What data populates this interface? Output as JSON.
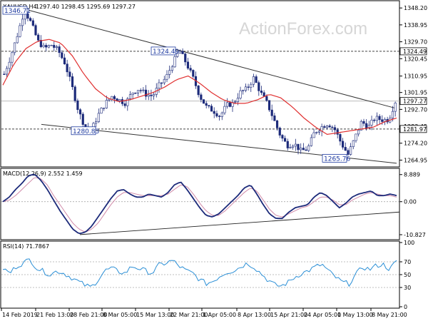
{
  "header": {
    "symbol": "XAUUSD,H4",
    "ohlc": "1297.40 1298.45 1295.69 1297.27",
    "macd_label": "MACD(12,26,9) 2.552 1.459",
    "rsi_label": "RSI(14) 71.7867"
  },
  "watermark": "ActionForex.com",
  "colors": {
    "candle": "#1c2a7a",
    "ma": "#e03030",
    "macd": "#1c2a7a",
    "signal": "#d08aa8",
    "rsi": "#2b8fd6",
    "trend": "#333333",
    "level_dash": "#444444",
    "annotation": "#1e3aa0"
  },
  "chart_data": [
    {
      "type": "candlestick",
      "title": "XAUUSD,H4",
      "ylim": [
        1262,
        1351
      ],
      "y_ticks": [
        "1348.20",
        "1338.95",
        "1329.70",
        "1320.45",
        "1310.95",
        "1301.95",
        "1292.70",
        "1283.45",
        "1274.20",
        "1264.95"
      ],
      "x_ticks": [
        "14 Feb 2019",
        "21 Feb 13:00",
        "28 Feb 21:00",
        "8 Mar 05:00",
        "15 Mar 13:00",
        "22 Mar 21:00",
        "1 Apr 05:00",
        "8 Apr 13:00",
        "15 Apr 21:00",
        "24 Apr 05:00",
        "1 May 13:00",
        "8 May 21:00"
      ],
      "price_path": [
        1312,
        1322,
        1334,
        1347,
        1340,
        1330,
        1326,
        1328,
        1325,
        1318,
        1306,
        1292,
        1283,
        1282,
        1290,
        1296,
        1300,
        1298,
        1296,
        1302,
        1304,
        1301,
        1300,
        1306,
        1310,
        1318,
        1325,
        1318,
        1310,
        1300,
        1294,
        1292,
        1289,
        1295,
        1296,
        1302,
        1304,
        1310,
        1302,
        1296,
        1287,
        1278,
        1273,
        1274,
        1270,
        1271,
        1280,
        1283,
        1285,
        1282,
        1274,
        1268,
        1277,
        1286,
        1283,
        1288,
        1287,
        1287,
        1297
      ],
      "moving_average": [
        1306,
        1318,
        1326,
        1330,
        1331,
        1329,
        1322,
        1312,
        1304,
        1299,
        1297,
        1298,
        1300,
        1302,
        1305,
        1309,
        1311,
        1307,
        1302,
        1298,
        1296,
        1296,
        1298,
        1301,
        1299,
        1294,
        1288,
        1283,
        1279,
        1280,
        1281,
        1282,
        1283,
        1286,
        1288
      ],
      "levels": [
        {
          "label": "1324.49",
          "value": 1324.49
        },
        {
          "label": "1297.27",
          "value": 1297.27
        },
        {
          "label": "1281.97",
          "value": 1281.97
        }
      ],
      "annotations": [
        {
          "label": "1346.71",
          "value": 1346.71
        },
        {
          "label": "1324.49",
          "value": 1324.49
        },
        {
          "label": "1280.83",
          "value": 1280.83
        },
        {
          "label": "1265.76",
          "value": 1265.76
        }
      ],
      "trendlines": [
        {
          "from": [
            "15 Feb 2019",
            1347
          ],
          "to": [
            "8 May 21:00",
            1293
          ]
        },
        {
          "from": [
            "27 Feb 2019",
            1284
          ],
          "to": [
            "9 May 2019",
            1263
          ]
        }
      ]
    },
    {
      "type": "line",
      "title": "MACD(12,26,9) 2.552 1.459",
      "ylim": [
        -12,
        10
      ],
      "y_ticks": [
        "8.889",
        "0.00",
        "-10.827"
      ],
      "series": [
        {
          "values": [
            0,
            1.5,
            4,
            6,
            8.5,
            9,
            7,
            4,
            0.5,
            -3,
            -6,
            -9,
            -10.5,
            -10,
            -8,
            -5,
            -2,
            1,
            3.5,
            4,
            2.5,
            1.5,
            1.5,
            2.5,
            2,
            1.5,
            3,
            5.5,
            6.5,
            4,
            1,
            -2,
            -4.5,
            -5,
            -4,
            -2,
            0,
            2,
            4.5,
            5.5,
            2.5,
            -1,
            -4,
            -5.5,
            -5.5,
            -3.5,
            -2,
            -1.5,
            -1,
            1.5,
            3,
            2,
            0,
            -2,
            -0.5,
            1.5,
            2.5,
            3,
            3.5,
            2,
            2,
            2.5,
            2
          ]
        },
        {
          "values": [
            0,
            0.5,
            2,
            4,
            6,
            8,
            7.5,
            5.5,
            2,
            -1,
            -4,
            -7,
            -9,
            -10,
            -9,
            -7,
            -4,
            -1,
            1.5,
            3,
            3,
            2.5,
            2,
            2,
            2,
            2,
            2.5,
            4,
            5.5,
            5,
            2.5,
            -0.5,
            -3,
            -4.5,
            -4.5,
            -3,
            -1,
            1,
            3,
            4.5,
            3.5,
            0.5,
            -2.5,
            -4.5,
            -5,
            -4,
            -3,
            -2,
            -1.5,
            0,
            1.5,
            1.5,
            0.5,
            -1,
            -1,
            0.5,
            1.5,
            2.5,
            3,
            2.5,
            2,
            2,
            1.5
          ]
        }
      ],
      "trendlines": [
        {
          "from": [
            "28 Feb 2019",
            -10.8
          ],
          "to": [
            "9 May 2019",
            -3.5
          ]
        }
      ]
    },
    {
      "type": "line",
      "title": "RSI(14) 71.7867",
      "ylim": [
        0,
        100
      ],
      "y_ticks": [
        "100",
        "70",
        "50",
        "30",
        "0"
      ],
      "values": [
        60,
        52,
        63,
        68,
        74,
        60,
        55,
        50,
        56,
        52,
        46,
        40,
        34,
        30,
        42,
        56,
        60,
        55,
        52,
        63,
        60,
        56,
        52,
        65,
        68,
        72,
        63,
        56,
        52,
        42,
        36,
        40,
        48,
        54,
        56,
        62,
        68,
        62,
        52,
        42,
        34,
        32,
        38,
        46,
        52,
        56,
        62,
        66,
        55,
        46,
        38,
        36,
        50,
        62,
        58,
        64,
        66,
        58,
        72
      ]
    }
  ]
}
